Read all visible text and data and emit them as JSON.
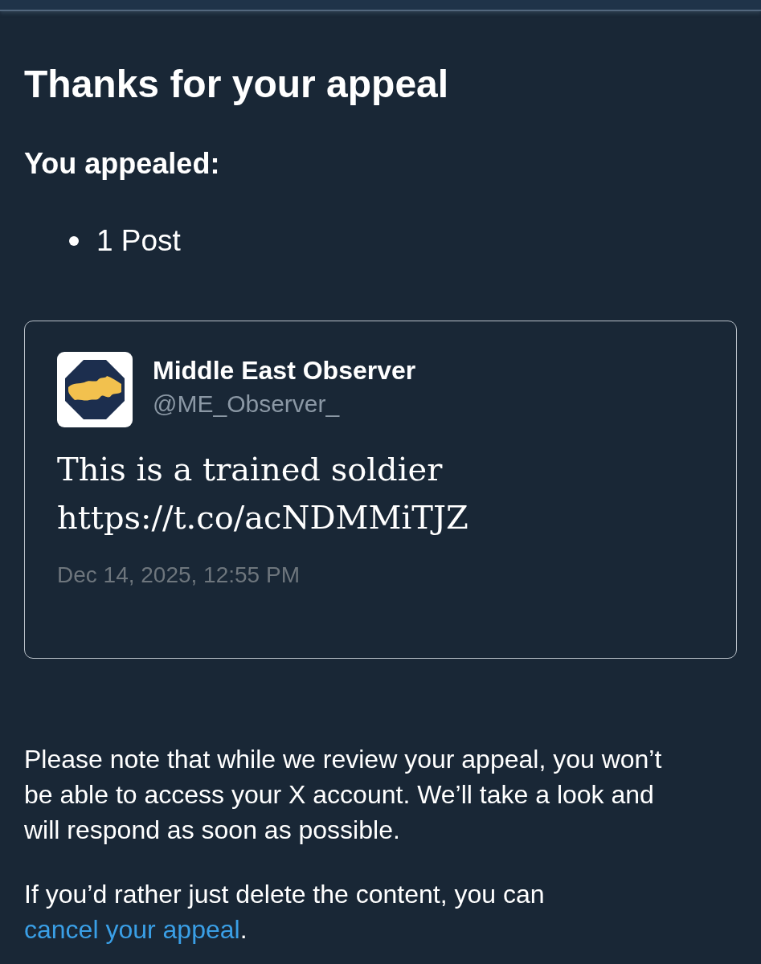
{
  "page": {
    "title": "Thanks for your appeal",
    "subtitle": "You appealed:",
    "appealed_items": [
      "1 Post"
    ]
  },
  "post": {
    "author_name": "Middle East Observer",
    "handle": "@ME_Observer_",
    "text": "This is a trained soldier https://t.co/acNDMMiTJZ",
    "timestamp": "Dec 14, 2025, 12:55 PM"
  },
  "notes": [
    {
      "text": "Please note that while we review your appeal, you won’t be able to access your X account. We’ll take a look and will respond as soon as possible."
    },
    {
      "text": "If you’d rather just delete the content, you can",
      "link": "cancel your appeal",
      "after_link": "."
    }
  ]
}
